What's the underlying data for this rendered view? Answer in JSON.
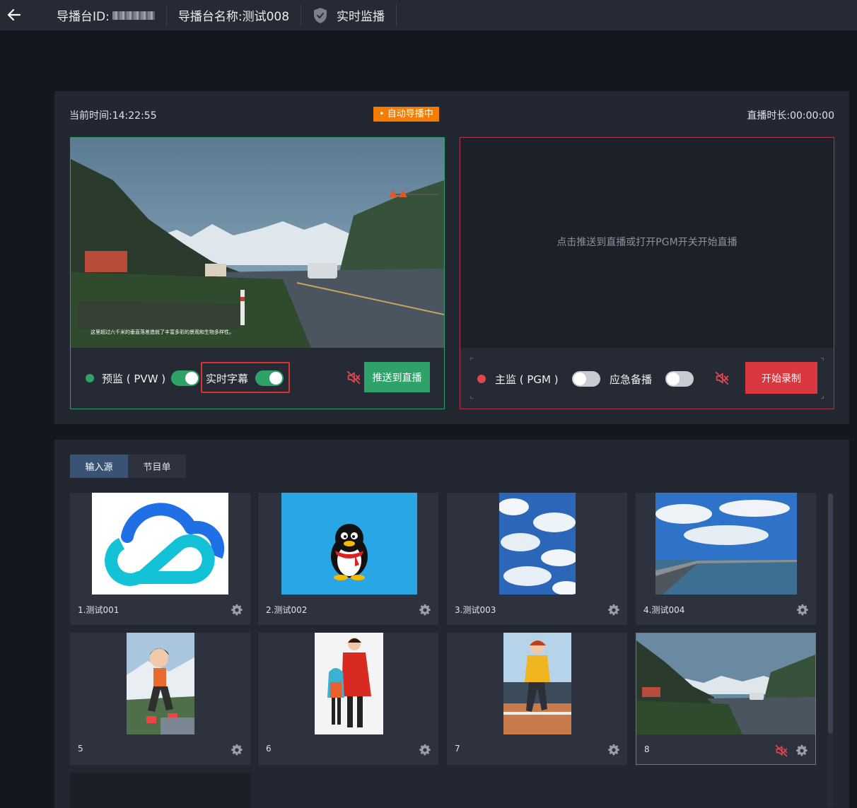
{
  "topbar": {
    "id_label": "导播台ID:",
    "name_label": "导播台名称:",
    "name_value": "测试008",
    "monitor_label": "实时监播"
  },
  "monitor": {
    "current_time_label": "当前时间:",
    "current_time": "14:22:55",
    "auto_badge": "• 自动导播中",
    "live_duration_label": "直播时长:",
    "live_duration": "00:00:00",
    "pvw": {
      "subtitle": "这里超过六千米的垂直落差造就了丰富多彩的景观和生物多样性。",
      "label": "预监 ( PVW )",
      "toggle_on": true,
      "caption_label": "实时字幕",
      "caption_on": true,
      "push_button": "推送到直播"
    },
    "pgm": {
      "hint": "点击推送到直播或打开PGM开关开始直播",
      "label": "主监 ( PGM )",
      "toggle_on": false,
      "backup_label": "应急备播",
      "backup_on": false,
      "record_button": "开始录制"
    }
  },
  "sources": {
    "tabs": [
      {
        "label": "输入源",
        "active": true
      },
      {
        "label": "节目单",
        "active": false
      }
    ],
    "items": [
      {
        "label": "1.测试001",
        "thumb": "cloud-logo"
      },
      {
        "label": "2.测试002",
        "thumb": "penguin"
      },
      {
        "label": "3.测试003",
        "thumb": "sky"
      },
      {
        "label": "4.测试004",
        "thumb": "pier"
      },
      {
        "label": "5",
        "thumb": "anime-girl"
      },
      {
        "label": "6",
        "thumb": "anime-pair"
      },
      {
        "label": "7",
        "thumb": "anime-runner"
      },
      {
        "label": "8",
        "thumb": "mountain-road",
        "active": true,
        "muted": true
      }
    ]
  },
  "colors": {
    "accent_green": "#2fa26a",
    "accent_red": "#d8383e",
    "badge_orange": "#f47c00",
    "tab_active": "#3a5274"
  }
}
